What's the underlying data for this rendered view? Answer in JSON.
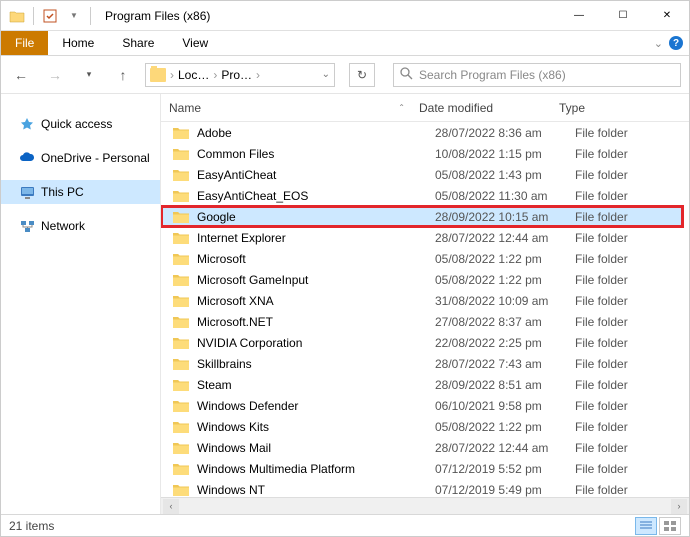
{
  "window": {
    "title": "Program Files (x86)"
  },
  "ribbon": {
    "file": "File",
    "home": "Home",
    "share": "Share",
    "view": "View"
  },
  "address": {
    "crumb1": "Loc…",
    "crumb2": "Pro…"
  },
  "search": {
    "placeholder": "Search Program Files (x86)"
  },
  "nav": {
    "quick": "Quick access",
    "onedrive": "OneDrive - Personal",
    "thispc": "This PC",
    "network": "Network"
  },
  "columns": {
    "name": "Name",
    "date": "Date modified",
    "type": "Type"
  },
  "type_label": "File folder",
  "rows": [
    {
      "name": "Adobe",
      "date": "28/07/2022 8:36 am"
    },
    {
      "name": "Common Files",
      "date": "10/08/2022 1:15 pm"
    },
    {
      "name": "EasyAntiCheat",
      "date": "05/08/2022 1:43 pm"
    },
    {
      "name": "EasyAntiCheat_EOS",
      "date": "05/08/2022 11:30 am"
    },
    {
      "name": "Google",
      "date": "28/09/2022 10:15 am"
    },
    {
      "name": "Internet Explorer",
      "date": "28/07/2022 12:44 am"
    },
    {
      "name": "Microsoft",
      "date": "05/08/2022 1:22 pm"
    },
    {
      "name": "Microsoft GameInput",
      "date": "05/08/2022 1:22 pm"
    },
    {
      "name": "Microsoft XNA",
      "date": "31/08/2022 10:09 am"
    },
    {
      "name": "Microsoft.NET",
      "date": "27/08/2022 8:37 am"
    },
    {
      "name": "NVIDIA Corporation",
      "date": "22/08/2022 2:25 pm"
    },
    {
      "name": "Skillbrains",
      "date": "28/07/2022 7:43 am"
    },
    {
      "name": "Steam",
      "date": "28/09/2022 8:51 am"
    },
    {
      "name": "Windows Defender",
      "date": "06/10/2021 9:58 pm"
    },
    {
      "name": "Windows Kits",
      "date": "05/08/2022 1:22 pm"
    },
    {
      "name": "Windows Mail",
      "date": "28/07/2022 12:44 am"
    },
    {
      "name": "Windows Multimedia Platform",
      "date": "07/12/2019 5:52 pm"
    },
    {
      "name": "Windows NT",
      "date": "07/12/2019 5:49 pm"
    }
  ],
  "status": {
    "count": "21 items"
  }
}
